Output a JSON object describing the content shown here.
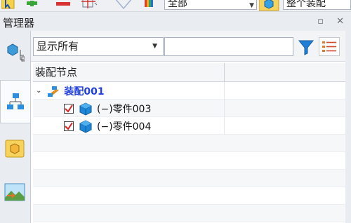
{
  "toolbar": {
    "combo1_value": "全部",
    "combo2_value": "整个装配"
  },
  "panel": {
    "title": "管理器",
    "pin_glyph": "▫",
    "close_glyph": "✕"
  },
  "filter": {
    "display_value": "显示所有",
    "text_value": ""
  },
  "tree": {
    "header_col1": "装配节点",
    "root_label": "装配001",
    "root_checked": true,
    "items": [
      {
        "label": "(−)零件003",
        "checked": true
      },
      {
        "label": "(−)零件004",
        "checked": true
      }
    ]
  },
  "colors": {
    "assembly_label": "#1f3fe0",
    "panel_bg": "#e9ecf1",
    "check_mark": "#e02020",
    "part_cube": "#1e88d8"
  }
}
